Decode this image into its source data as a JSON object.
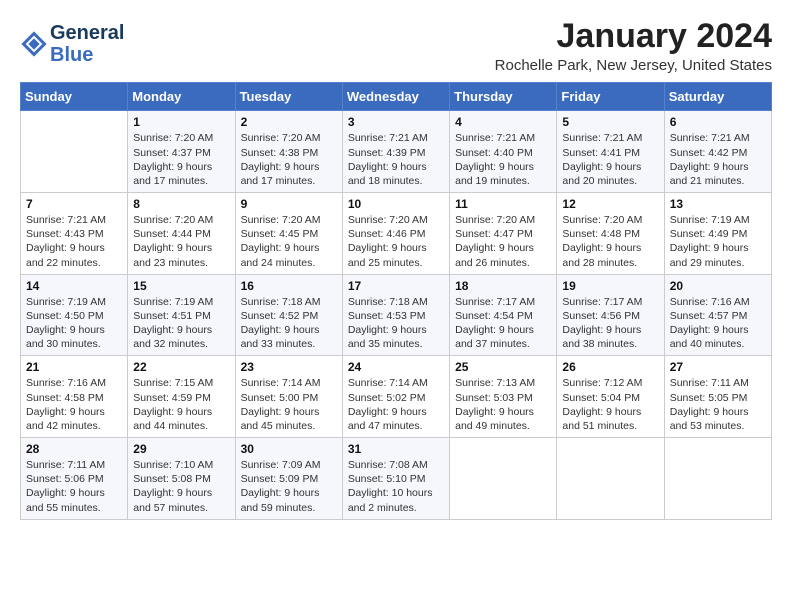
{
  "header": {
    "logo_line1": "General",
    "logo_line2": "Blue",
    "month": "January 2024",
    "location": "Rochelle Park, New Jersey, United States"
  },
  "weekdays": [
    "Sunday",
    "Monday",
    "Tuesday",
    "Wednesday",
    "Thursday",
    "Friday",
    "Saturday"
  ],
  "weeks": [
    [
      {
        "day": "",
        "info": ""
      },
      {
        "day": "1",
        "info": "Sunrise: 7:20 AM\nSunset: 4:37 PM\nDaylight: 9 hours\nand 17 minutes."
      },
      {
        "day": "2",
        "info": "Sunrise: 7:20 AM\nSunset: 4:38 PM\nDaylight: 9 hours\nand 17 minutes."
      },
      {
        "day": "3",
        "info": "Sunrise: 7:21 AM\nSunset: 4:39 PM\nDaylight: 9 hours\nand 18 minutes."
      },
      {
        "day": "4",
        "info": "Sunrise: 7:21 AM\nSunset: 4:40 PM\nDaylight: 9 hours\nand 19 minutes."
      },
      {
        "day": "5",
        "info": "Sunrise: 7:21 AM\nSunset: 4:41 PM\nDaylight: 9 hours\nand 20 minutes."
      },
      {
        "day": "6",
        "info": "Sunrise: 7:21 AM\nSunset: 4:42 PM\nDaylight: 9 hours\nand 21 minutes."
      }
    ],
    [
      {
        "day": "7",
        "info": "Sunrise: 7:21 AM\nSunset: 4:43 PM\nDaylight: 9 hours\nand 22 minutes."
      },
      {
        "day": "8",
        "info": "Sunrise: 7:20 AM\nSunset: 4:44 PM\nDaylight: 9 hours\nand 23 minutes."
      },
      {
        "day": "9",
        "info": "Sunrise: 7:20 AM\nSunset: 4:45 PM\nDaylight: 9 hours\nand 24 minutes."
      },
      {
        "day": "10",
        "info": "Sunrise: 7:20 AM\nSunset: 4:46 PM\nDaylight: 9 hours\nand 25 minutes."
      },
      {
        "day": "11",
        "info": "Sunrise: 7:20 AM\nSunset: 4:47 PM\nDaylight: 9 hours\nand 26 minutes."
      },
      {
        "day": "12",
        "info": "Sunrise: 7:20 AM\nSunset: 4:48 PM\nDaylight: 9 hours\nand 28 minutes."
      },
      {
        "day": "13",
        "info": "Sunrise: 7:19 AM\nSunset: 4:49 PM\nDaylight: 9 hours\nand 29 minutes."
      }
    ],
    [
      {
        "day": "14",
        "info": "Sunrise: 7:19 AM\nSunset: 4:50 PM\nDaylight: 9 hours\nand 30 minutes."
      },
      {
        "day": "15",
        "info": "Sunrise: 7:19 AM\nSunset: 4:51 PM\nDaylight: 9 hours\nand 32 minutes."
      },
      {
        "day": "16",
        "info": "Sunrise: 7:18 AM\nSunset: 4:52 PM\nDaylight: 9 hours\nand 33 minutes."
      },
      {
        "day": "17",
        "info": "Sunrise: 7:18 AM\nSunset: 4:53 PM\nDaylight: 9 hours\nand 35 minutes."
      },
      {
        "day": "18",
        "info": "Sunrise: 7:17 AM\nSunset: 4:54 PM\nDaylight: 9 hours\nand 37 minutes."
      },
      {
        "day": "19",
        "info": "Sunrise: 7:17 AM\nSunset: 4:56 PM\nDaylight: 9 hours\nand 38 minutes."
      },
      {
        "day": "20",
        "info": "Sunrise: 7:16 AM\nSunset: 4:57 PM\nDaylight: 9 hours\nand 40 minutes."
      }
    ],
    [
      {
        "day": "21",
        "info": "Sunrise: 7:16 AM\nSunset: 4:58 PM\nDaylight: 9 hours\nand 42 minutes."
      },
      {
        "day": "22",
        "info": "Sunrise: 7:15 AM\nSunset: 4:59 PM\nDaylight: 9 hours\nand 44 minutes."
      },
      {
        "day": "23",
        "info": "Sunrise: 7:14 AM\nSunset: 5:00 PM\nDaylight: 9 hours\nand 45 minutes."
      },
      {
        "day": "24",
        "info": "Sunrise: 7:14 AM\nSunset: 5:02 PM\nDaylight: 9 hours\nand 47 minutes."
      },
      {
        "day": "25",
        "info": "Sunrise: 7:13 AM\nSunset: 5:03 PM\nDaylight: 9 hours\nand 49 minutes."
      },
      {
        "day": "26",
        "info": "Sunrise: 7:12 AM\nSunset: 5:04 PM\nDaylight: 9 hours\nand 51 minutes."
      },
      {
        "day": "27",
        "info": "Sunrise: 7:11 AM\nSunset: 5:05 PM\nDaylight: 9 hours\nand 53 minutes."
      }
    ],
    [
      {
        "day": "28",
        "info": "Sunrise: 7:11 AM\nSunset: 5:06 PM\nDaylight: 9 hours\nand 55 minutes."
      },
      {
        "day": "29",
        "info": "Sunrise: 7:10 AM\nSunset: 5:08 PM\nDaylight: 9 hours\nand 57 minutes."
      },
      {
        "day": "30",
        "info": "Sunrise: 7:09 AM\nSunset: 5:09 PM\nDaylight: 9 hours\nand 59 minutes."
      },
      {
        "day": "31",
        "info": "Sunrise: 7:08 AM\nSunset: 5:10 PM\nDaylight: 10 hours\nand 2 minutes."
      },
      {
        "day": "",
        "info": ""
      },
      {
        "day": "",
        "info": ""
      },
      {
        "day": "",
        "info": ""
      }
    ]
  ]
}
